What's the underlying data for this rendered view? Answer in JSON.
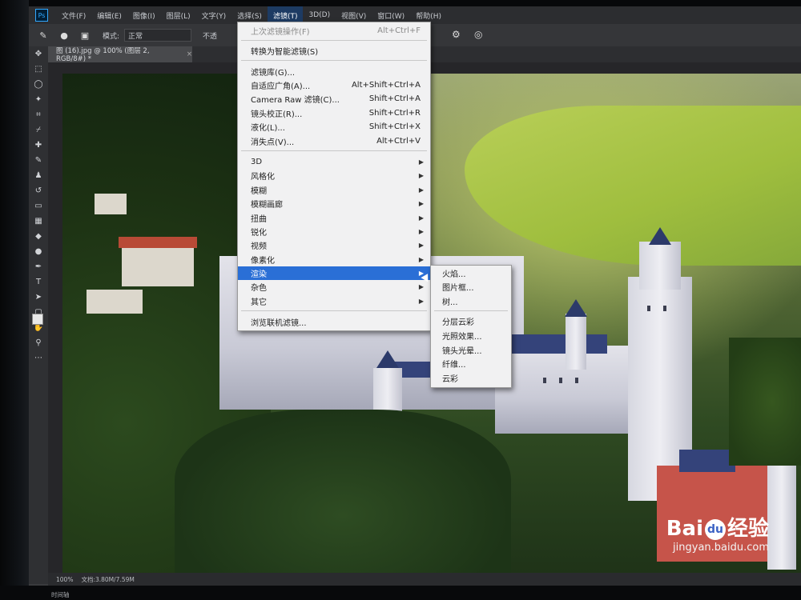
{
  "menubar": {
    "items": [
      "文件(F)",
      "编辑(E)",
      "图像(I)",
      "图层(L)",
      "文字(Y)",
      "选择(S)",
      "滤镜(T)",
      "3D(D)",
      "视图(V)",
      "窗口(W)",
      "帮助(H)"
    ],
    "active_index": 6
  },
  "options": {
    "mode_label": "模式:",
    "mode_value": "正常",
    "opacity_label": "不透"
  },
  "document": {
    "tab_title": "图 (16).jpg @ 100% (图层 2, RGB/8#) *",
    "close": "×"
  },
  "status": {
    "zoom": "100%",
    "doc_size": "文档:3.80M/7.59M",
    "timeline": "时间轴"
  },
  "filter_menu": {
    "items": [
      {
        "label": "上次滤镜操作(F)",
        "shortcut": "Alt+Ctrl+F",
        "disabled": true
      },
      {
        "label": "转换为智能滤镜(S)"
      },
      {
        "label": "滤镜库(G)..."
      },
      {
        "label": "自适应广角(A)...",
        "shortcut": "Alt+Shift+Ctrl+A"
      },
      {
        "label": "Camera Raw 滤镜(C)...",
        "shortcut": "Shift+Ctrl+A"
      },
      {
        "label": "镜头校正(R)...",
        "shortcut": "Shift+Ctrl+R"
      },
      {
        "label": "液化(L)...",
        "shortcut": "Shift+Ctrl+X"
      },
      {
        "label": "消失点(V)...",
        "shortcut": "Alt+Ctrl+V"
      },
      {
        "label": "3D",
        "submenu": true
      },
      {
        "label": "风格化",
        "submenu": true
      },
      {
        "label": "模糊",
        "submenu": true
      },
      {
        "label": "模糊画廊",
        "submenu": true
      },
      {
        "label": "扭曲",
        "submenu": true
      },
      {
        "label": "锐化",
        "submenu": true
      },
      {
        "label": "视频",
        "submenu": true
      },
      {
        "label": "像素化",
        "submenu": true
      },
      {
        "label": "渲染",
        "submenu": true,
        "highlighted": true
      },
      {
        "label": "杂色",
        "submenu": true
      },
      {
        "label": "其它",
        "submenu": true
      },
      {
        "label": "浏览联机滤镜..."
      }
    ]
  },
  "render_submenu": {
    "items": [
      "火焰...",
      "图片框...",
      "树...",
      "分层云彩",
      "光照效果...",
      "镜头光晕...",
      "纤维...",
      "云彩"
    ]
  },
  "watermark": {
    "brand_left": "Bai",
    "brand_paw": "du",
    "brand_right": "经验",
    "url": "jingyan.baidu.com"
  },
  "colors": {
    "menu_highlight": "#2a6fd6",
    "menubar_active": "#1d3b63",
    "ps_accent": "#31a8ff"
  }
}
